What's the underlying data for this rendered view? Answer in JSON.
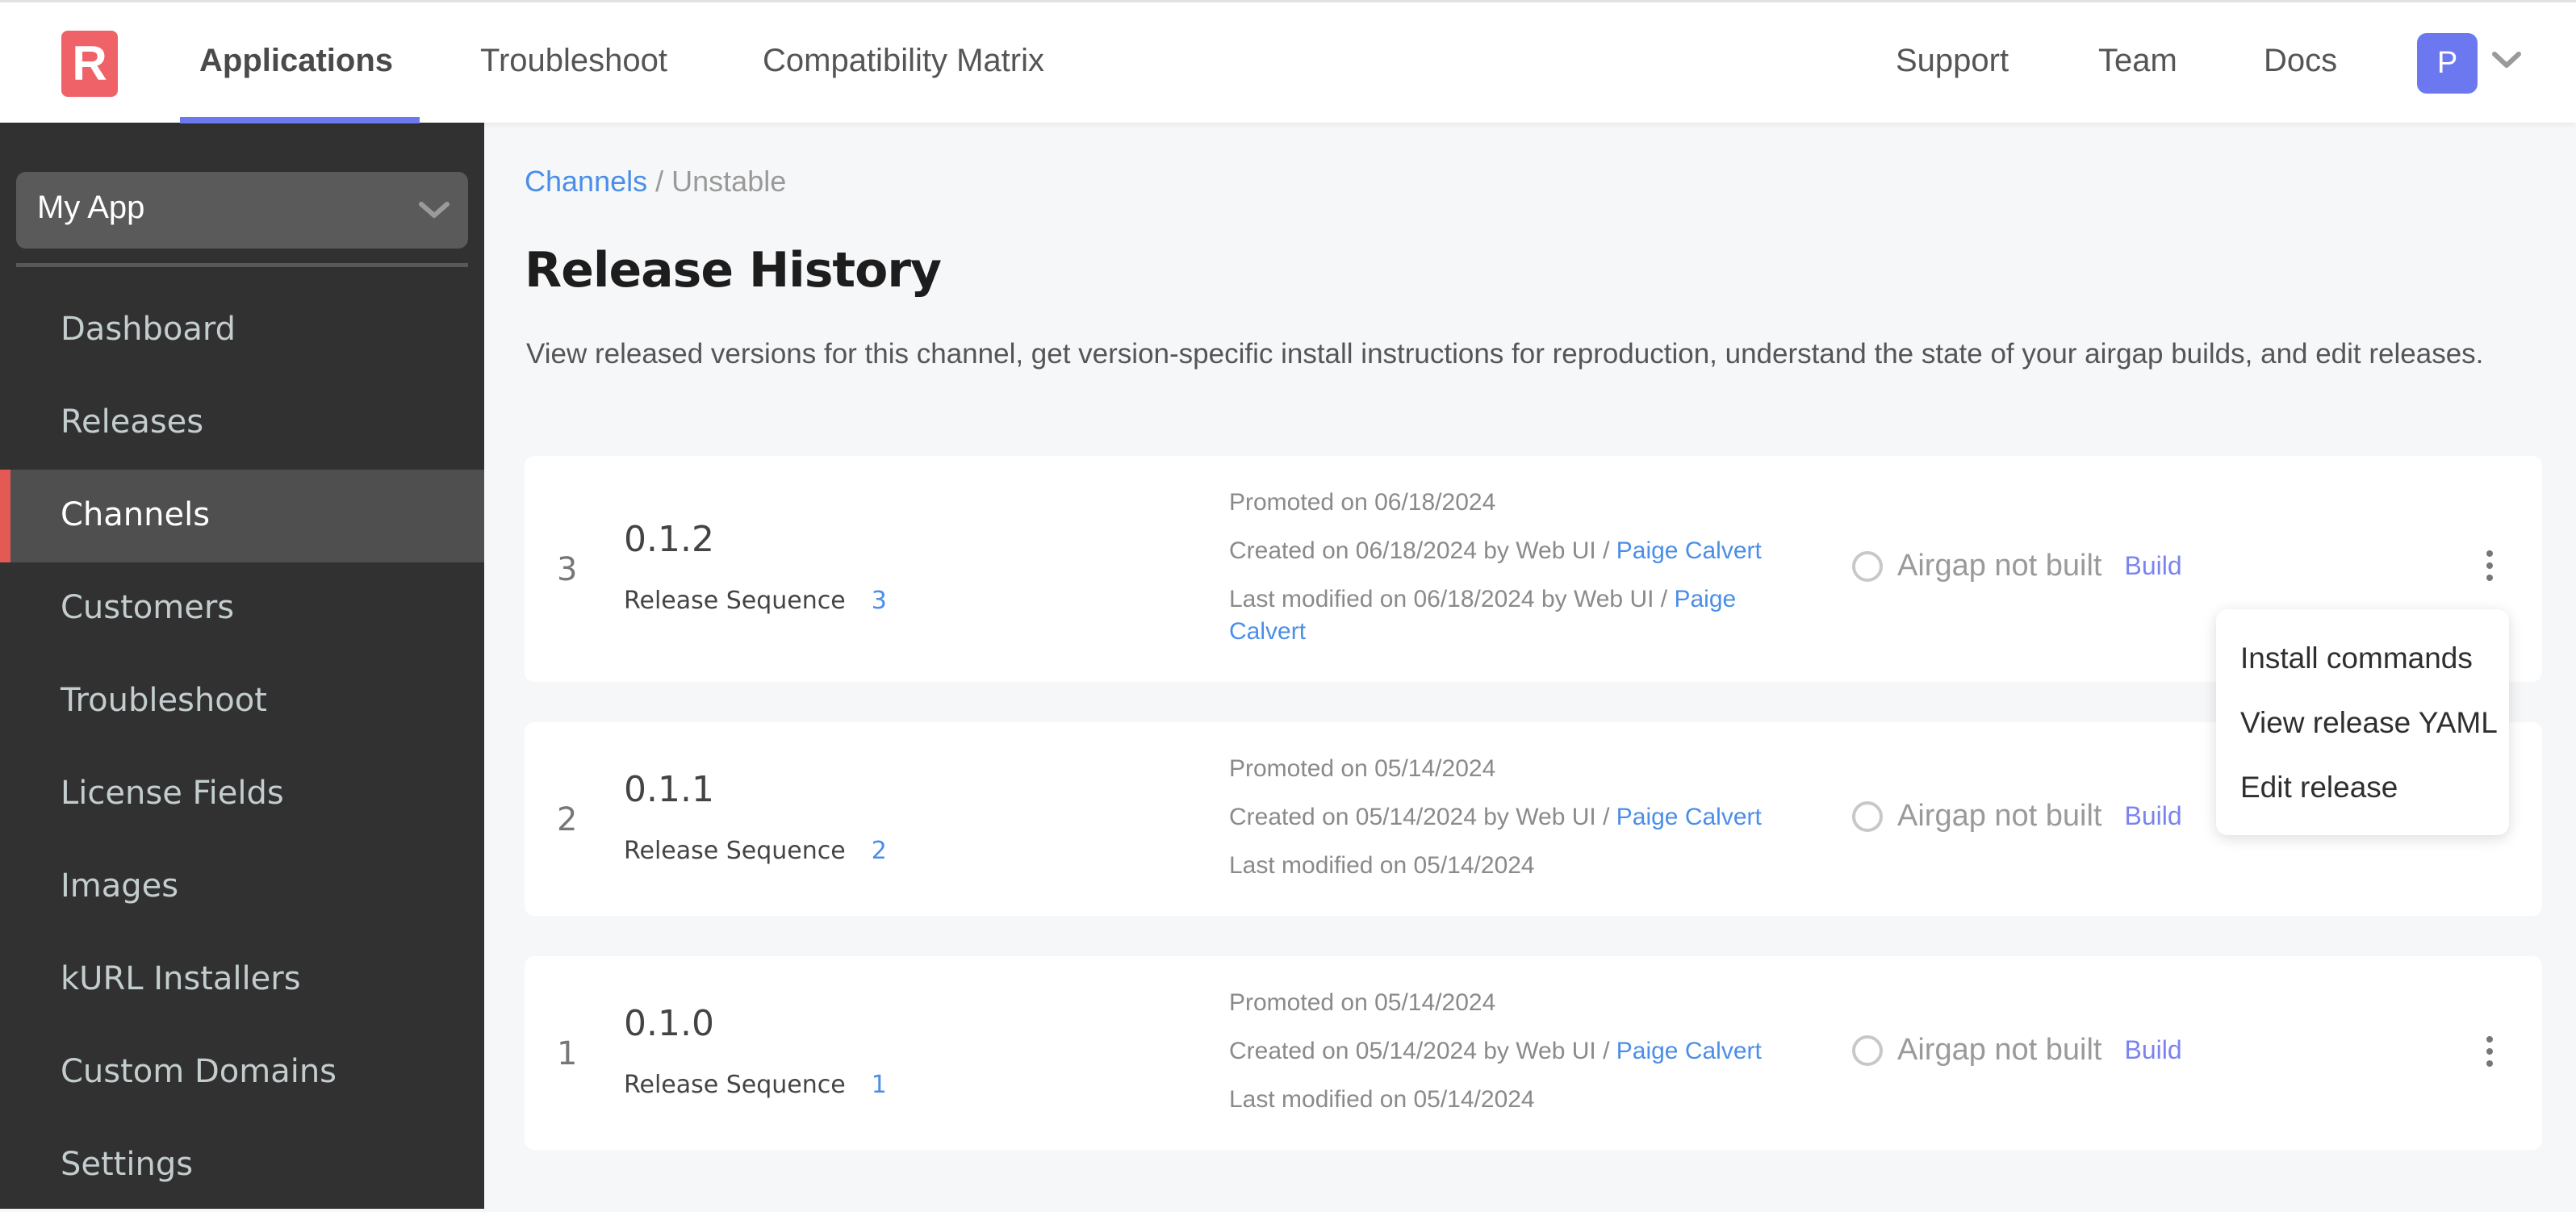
{
  "topbar": {
    "logo_letter": "R",
    "nav": [
      {
        "label": "Applications",
        "active": true
      },
      {
        "label": "Troubleshoot",
        "active": false
      },
      {
        "label": "Compatibility Matrix",
        "active": false
      }
    ],
    "right_nav": [
      {
        "label": "Support"
      },
      {
        "label": "Team"
      },
      {
        "label": "Docs"
      }
    ],
    "avatar_initial": "P",
    "accent_color": "#6c78f0"
  },
  "sidebar": {
    "app_selector": {
      "value": "My App",
      "icon": "chevron-down-icon"
    },
    "items": [
      {
        "label": "Dashboard",
        "active": false
      },
      {
        "label": "Releases",
        "active": false
      },
      {
        "label": "Channels",
        "active": true
      },
      {
        "label": "Customers",
        "active": false
      },
      {
        "label": "Troubleshoot",
        "active": false
      },
      {
        "label": "License Fields",
        "active": false
      },
      {
        "label": "Images",
        "active": false
      },
      {
        "label": "kURL Installers",
        "active": false
      },
      {
        "label": "Custom Domains",
        "active": false
      },
      {
        "label": "Settings",
        "active": false
      }
    ],
    "active_indicator_color": "#e35a55"
  },
  "main": {
    "breadcrumb": {
      "parent": "Channels",
      "separator": "/",
      "current": "Unstable"
    },
    "title": "Release History",
    "description": "View released versions for this channel, get version-specific install instructions for reproduction, understand the state of your airgap builds, and edit releases.",
    "releases": [
      {
        "index": "3",
        "version": "0.1.2",
        "sequence_label": "Release Sequence",
        "sequence": "3",
        "promoted": "Promoted on 06/18/2024",
        "created_prefix": "Created on 06/18/2024 by Web UI / ",
        "created_user": "Paige Calvert",
        "modified_prefix": "Last modified on 06/18/2024 by Web UI / ",
        "modified_user": "Paige Calvert",
        "airgap_status": "Airgap not built",
        "build_label": "Build",
        "menu_open": true
      },
      {
        "index": "2",
        "version": "0.1.1",
        "sequence_label": "Release Sequence",
        "sequence": "2",
        "promoted": "Promoted on 05/14/2024",
        "created_prefix": "Created on 05/14/2024 by Web UI / ",
        "created_user": "Paige Calvert",
        "modified_prefix": "Last modified on 05/14/2024",
        "modified_user": "",
        "airgap_status": "Airgap not built",
        "build_label": "Build",
        "menu_open": false
      },
      {
        "index": "1",
        "version": "0.1.0",
        "sequence_label": "Release Sequence",
        "sequence": "1",
        "promoted": "Promoted on 05/14/2024",
        "created_prefix": "Created on 05/14/2024 by Web UI / ",
        "created_user": "Paige Calvert",
        "modified_prefix": "Last modified on 05/14/2024",
        "modified_user": "",
        "airgap_status": "Airgap not built",
        "build_label": "Build",
        "menu_open": false
      }
    ],
    "release_menu": {
      "items": [
        {
          "label": "Install commands"
        },
        {
          "label": "View release YAML"
        },
        {
          "label": "Edit release"
        }
      ]
    }
  }
}
